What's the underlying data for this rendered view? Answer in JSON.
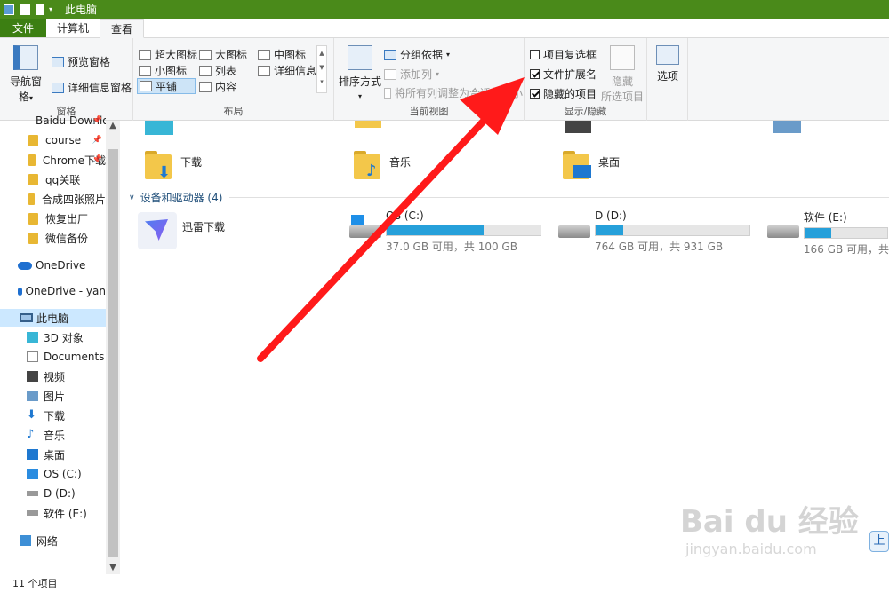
{
  "window": {
    "title": "此电脑"
  },
  "tabs": [
    {
      "label": "文件"
    },
    {
      "label": "计算机"
    },
    {
      "label": "查看"
    }
  ],
  "ribbon": {
    "panes": {
      "label": "窗格",
      "nav_pane": "导航窗格",
      "preview": "预览窗格",
      "details": "详细信息窗格"
    },
    "layout": {
      "label": "布局",
      "items": [
        "超大图标",
        "大图标",
        "中图标",
        "小图标",
        "列表",
        "详细信息",
        "平铺",
        "内容"
      ],
      "selected": "平铺"
    },
    "current_view": {
      "label": "当前视图",
      "sort": "排序方式",
      "group_by": "分组依据",
      "add_columns": "添加列",
      "fit_columns": "将所有列调整为合适的大小"
    },
    "show_hide": {
      "label": "显示/隐藏",
      "checkboxes": [
        {
          "label": "项目复选框",
          "checked": false
        },
        {
          "label": "文件扩展名",
          "checked": true
        },
        {
          "label": "隐藏的项目",
          "checked": true
        }
      ],
      "hide": "隐藏",
      "hide_sub": "所选项目"
    },
    "options": "选项"
  },
  "nav": {
    "items": [
      {
        "label": "Baidu Downlo",
        "type": "folder",
        "pinned": true
      },
      {
        "label": "course",
        "type": "folder",
        "pinned": true
      },
      {
        "label": "Chrome下载",
        "type": "folder",
        "pinned": true
      },
      {
        "label": "qq关联",
        "type": "folder"
      },
      {
        "label": "合成四张照片",
        "type": "folder"
      },
      {
        "label": "恢复出厂",
        "type": "folder"
      },
      {
        "label": "微信备份",
        "type": "folder"
      },
      {
        "label": "OneDrive",
        "type": "cloud"
      },
      {
        "label": "OneDrive - yan",
        "type": "cloud"
      },
      {
        "label": "此电脑",
        "type": "pc"
      },
      {
        "label": "3D 对象",
        "type": "3d"
      },
      {
        "label": "Documents",
        "type": "doc"
      },
      {
        "label": "视频",
        "type": "video"
      },
      {
        "label": "图片",
        "type": "pic"
      },
      {
        "label": "下载",
        "type": "down"
      },
      {
        "label": "音乐",
        "type": "music"
      },
      {
        "label": "桌面",
        "type": "desk"
      },
      {
        "label": "OS (C:)",
        "type": "win"
      },
      {
        "label": "D (D:)",
        "type": "drive"
      },
      {
        "label": "软件 (E:)",
        "type": "drive"
      },
      {
        "label": "网络",
        "type": "net"
      }
    ]
  },
  "main": {
    "folders": [
      {
        "label": "下载"
      },
      {
        "label": "音乐"
      },
      {
        "label": "桌面"
      }
    ],
    "devices_header": "设备和驱动器 (4)",
    "devices": [
      {
        "label": "迅雷下载"
      },
      {
        "label": "OS (C:)",
        "free": "37.0 GB 可用，共 100 GB",
        "used_fraction": 0.63
      },
      {
        "label": "D (D:)",
        "free": "764 GB 可用，共 931 GB",
        "used_fraction": 0.18
      },
      {
        "label": "软件 (E:)",
        "free": "166 GB 可用，共",
        "used_fraction": 0.17
      }
    ]
  },
  "status": {
    "count": "11 个项目"
  },
  "watermark": {
    "main": "Bai du 经验",
    "sub": "jingyan.baidu.com"
  },
  "side_button": "上",
  "colors": {
    "accent": "#3c7f12",
    "titlebar": "#4a8a1a",
    "bar_fill": "#26a0da",
    "arrow": "#ff1a1a"
  }
}
